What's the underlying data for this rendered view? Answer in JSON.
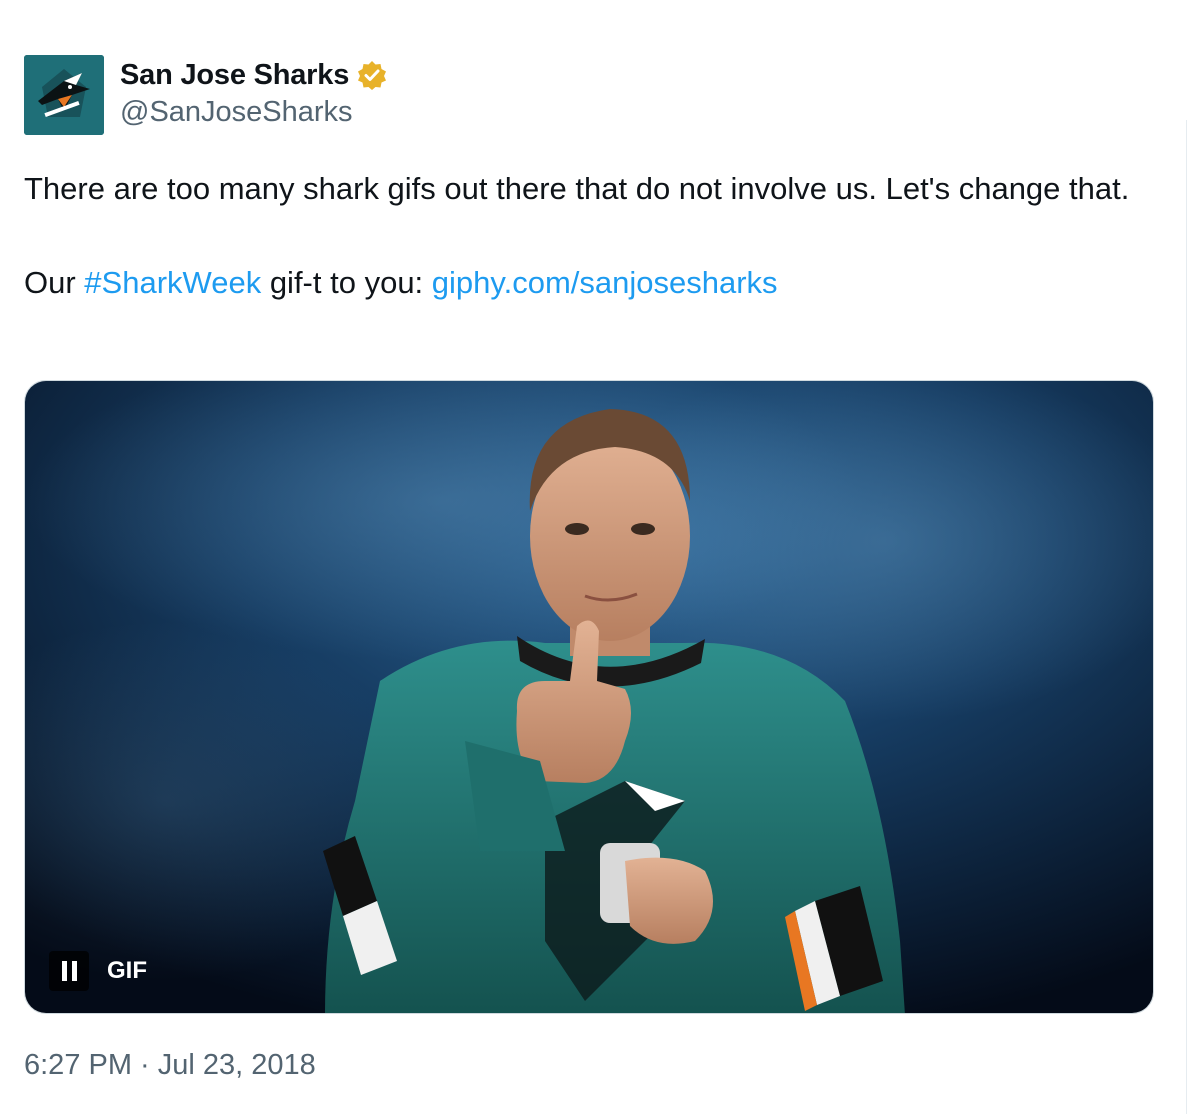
{
  "tweet": {
    "author": {
      "display_name": "San Jose Sharks",
      "handle": "@SanJoseSharks",
      "verified": true,
      "verified_color": "#e8b22a",
      "avatar_icon": "sharks-logo-icon",
      "avatar_bg": "#1f6f78"
    },
    "text": {
      "line1": "There are too many shark gifs out there that do not involve us. Let's change that.",
      "line2_prefix": "Our ",
      "hashtag": "#SharkWeek",
      "line2_middle": " gif-t to you: ",
      "url": "giphy.com/sanjosesharks"
    },
    "link_color": "#1d9bf0",
    "media": {
      "type": "gif",
      "badge": "GIF",
      "pause_icon": "pause-icon"
    },
    "timestamp": "6:27 PM · Jul 23, 2018"
  }
}
